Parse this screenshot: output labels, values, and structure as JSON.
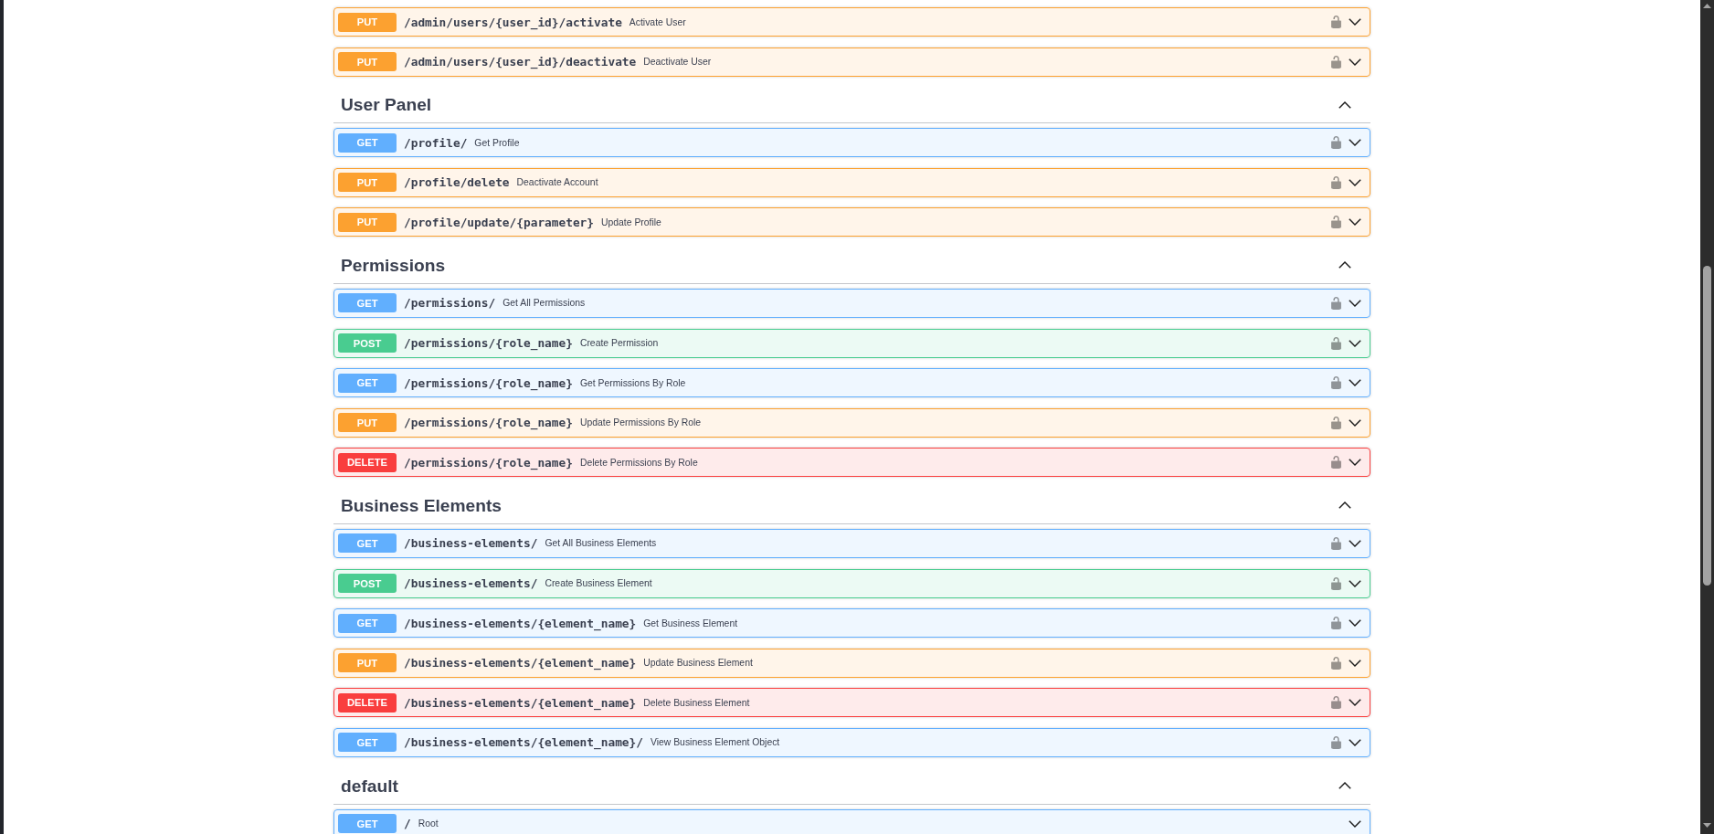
{
  "sections": [
    {
      "operations": [
        {
          "method": "PUT",
          "color": "#fca130",
          "path": "/admin/users/{user_id}/activate",
          "summary": "Activate User",
          "secured": true,
          "expanded": false
        },
        {
          "method": "PUT",
          "color": "#fca130",
          "path": "/admin/users/{user_id}/deactivate",
          "summary": "Deactivate User",
          "secured": true,
          "expanded": false
        }
      ]
    },
    {
      "title": "User Panel",
      "expanded": true,
      "operations": [
        {
          "method": "GET",
          "color": "#61affe",
          "path": "/profile/",
          "summary": "Get Profile",
          "secured": true,
          "expanded": false
        },
        {
          "method": "PUT",
          "color": "#fca130",
          "path": "/profile/delete",
          "summary": "Deactivate Account",
          "secured": true,
          "expanded": false
        },
        {
          "method": "PUT",
          "color": "#fca130",
          "path": "/profile/update/{parameter}",
          "summary": "Update Profile",
          "secured": true,
          "expanded": false
        }
      ]
    },
    {
      "title": "Permissions",
      "expanded": true,
      "operations": [
        {
          "method": "GET",
          "color": "#61affe",
          "path": "/permissions/",
          "summary": "Get All Permissions",
          "secured": true,
          "expanded": false
        },
        {
          "method": "POST",
          "color": "#49cc90",
          "path": "/permissions/{role_name}",
          "summary": "Create Permission",
          "secured": true,
          "expanded": false
        },
        {
          "method": "GET",
          "color": "#61affe",
          "path": "/permissions/{role_name}",
          "summary": "Get Permissions By Role",
          "secured": true,
          "expanded": false
        },
        {
          "method": "PUT",
          "color": "#fca130",
          "path": "/permissions/{role_name}",
          "summary": "Update Permissions By Role",
          "secured": true,
          "expanded": false
        },
        {
          "method": "DELETE",
          "color": "#f93e3e",
          "path": "/permissions/{role_name}",
          "summary": "Delete Permissions By Role",
          "secured": true,
          "expanded": false
        }
      ]
    },
    {
      "title": "Business Elements",
      "expanded": true,
      "operations": [
        {
          "method": "GET",
          "color": "#61affe",
          "path": "/business-elements/",
          "summary": "Get All Business Elements",
          "secured": true,
          "expanded": false
        },
        {
          "method": "POST",
          "color": "#49cc90",
          "path": "/business-elements/",
          "summary": "Create Business Element",
          "secured": true,
          "expanded": false
        },
        {
          "method": "GET",
          "color": "#61affe",
          "path": "/business-elements/{element_name}",
          "summary": "Get Business Element",
          "secured": true,
          "expanded": false
        },
        {
          "method": "PUT",
          "color": "#fca130",
          "path": "/business-elements/{element_name}",
          "summary": "Update Business Element",
          "secured": true,
          "expanded": false
        },
        {
          "method": "DELETE",
          "color": "#f93e3e",
          "path": "/business-elements/{element_name}",
          "summary": "Delete Business Element",
          "secured": true,
          "expanded": false
        },
        {
          "method": "GET",
          "color": "#61affe",
          "path": "/business-elements/{element_name}/",
          "summary": "View Business Element Object",
          "secured": true,
          "expanded": false
        }
      ]
    },
    {
      "title": "default",
      "expanded": true,
      "operations": [
        {
          "method": "GET",
          "color": "#61affe",
          "path": "/",
          "summary": "Root",
          "secured": false,
          "expanded": false
        }
      ]
    }
  ]
}
